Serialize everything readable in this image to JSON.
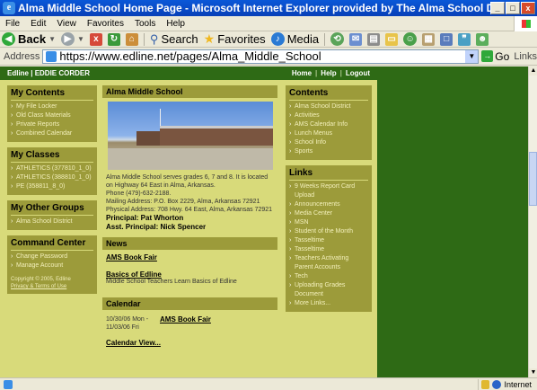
{
  "window": {
    "title": "Alma Middle School Home Page - Microsoft Internet Explorer provided by The Alma School District",
    "controls": [
      "_",
      "□",
      "x"
    ]
  },
  "menu": [
    "File",
    "Edit",
    "View",
    "Favorites",
    "Tools",
    "Help"
  ],
  "toolbar": {
    "back": "Back",
    "search": "Search",
    "favorites": "Favorites",
    "media": "Media"
  },
  "address": {
    "label": "Address",
    "url": "https://www.edline.net/pages/Alma_Middle_School",
    "go": "Go",
    "links": "Links"
  },
  "site": {
    "top_left": "Edline | EDDIE CORDER",
    "top_links": [
      "Home",
      "Help",
      "Logout"
    ],
    "my_contents": {
      "title": "My Contents",
      "items": [
        "My File Locker",
        "Old Class Materials",
        "Private Reports",
        "Combined Calendar"
      ]
    },
    "my_classes": {
      "title": "My Classes",
      "items": [
        "ATHLETICS (377810_1_0)",
        "ATHLETICS (388810_1_0)",
        "PE (358811_8_0)"
      ]
    },
    "my_other_groups": {
      "title": "My Other Groups",
      "items": [
        "Alma School District"
      ]
    },
    "command_center": {
      "title": "Command Center",
      "items": [
        "Change Password",
        "Manage Account"
      ],
      "copyright": "Copyright © 2005, Edline",
      "privacy": "Privacy & Terms of Use"
    },
    "school": {
      "title": "Alma Middle School",
      "description": "Alma Middle School serves grades 6, 7 and 8. It is located on Highway 64 East in Alma, Arkansas.",
      "phone": "Phone (479)-632-2188.",
      "mailing": "Mailing Address: P.O. Box 2229, Alma, Arkansas 72921",
      "physical": "Physical Address: 708 Hwy. 64 East, Alma, Arkansas 72921",
      "principal": "Principal: Pat Whorton",
      "asst_principal": "Asst. Principal: Nick Spencer"
    },
    "news": {
      "title": "News",
      "items": [
        {
          "title": "AMS Book Fair",
          "sub": ""
        },
        {
          "title": "Basics of Edline",
          "sub": "Middle School Teachers Learn Basics of Edline"
        }
      ]
    },
    "calendar": {
      "title": "Calendar",
      "date": "10/30/06 Mon - 11/03/06 Fri",
      "event": "AMS Book Fair",
      "view": "Calendar View..."
    },
    "contents": {
      "title": "Contents",
      "items": [
        "Alma School District",
        "Activities",
        "AMS Calendar Info",
        "Lunch Menus",
        "School Info",
        "Sports"
      ]
    },
    "links": {
      "title": "Links",
      "items": [
        "9 Weeks Report Card Upload",
        "Announcements",
        "Media Center",
        "MSN",
        "Student of the Month",
        "Tasseltime",
        "Tasseltime",
        "Teachers Activating Parent Accounts",
        "Tech",
        "Uploading Grades Document",
        "More Links..."
      ]
    }
  },
  "status": {
    "zone": "Internet"
  }
}
